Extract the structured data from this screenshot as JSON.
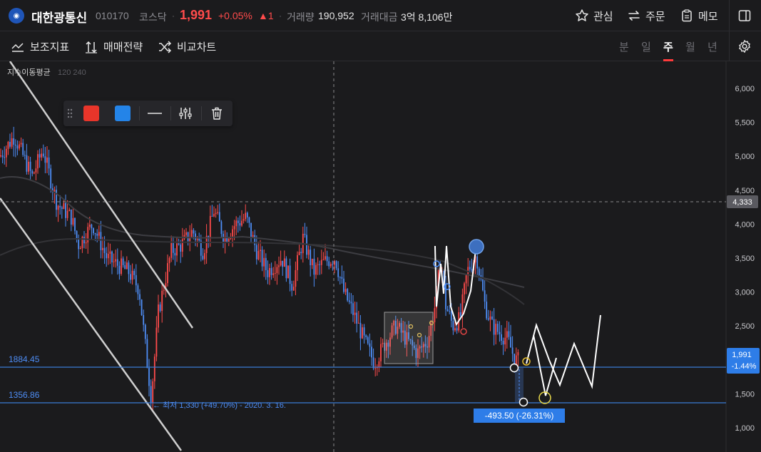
{
  "header": {
    "stock_name": "대한광통신",
    "stock_code": "010170",
    "market": "코스닥",
    "price": "1,991",
    "change_pct": "+0.05%",
    "change_val": "▲1",
    "volume_label": "거래량",
    "volume": "190,952",
    "amount_label": "거래대금",
    "amount": "3억 8,106만",
    "watch_label": "관심",
    "order_label": "주문",
    "memo_label": "메모"
  },
  "toolbar": {
    "indicator_label": "보조지표",
    "strategy_label": "매매전략",
    "compare_label": "비교차트",
    "periods": [
      "분",
      "일",
      "주",
      "월",
      "년"
    ],
    "active_period": "주"
  },
  "chart_data": {
    "type": "candlestick",
    "legend": "지수이동평균",
    "legend_ma": "120 240",
    "y_ticks": [
      "6,000",
      "5,500",
      "5,000",
      "4,500",
      "4,000",
      "3,500",
      "3,000",
      "2,500",
      "2,000",
      "1,500",
      "1,000"
    ],
    "y_range": [
      1000,
      6000
    ],
    "crosshair_price": "4,333",
    "current_price": "1,991",
    "current_change": "-1.44%",
    "hline1": "1884.45",
    "hline2": "1356.86",
    "low_annotation": "← 최저 1,330 (+49.70%) - 2020. 3. 16.",
    "measure_label": "-493.50 (-26.31%)",
    "colors": {
      "up": "#ff4b4b",
      "down": "#4e8df5"
    }
  },
  "drawing_toolbar": {
    "colors": [
      "#e8352a",
      "#2484e8"
    ]
  }
}
